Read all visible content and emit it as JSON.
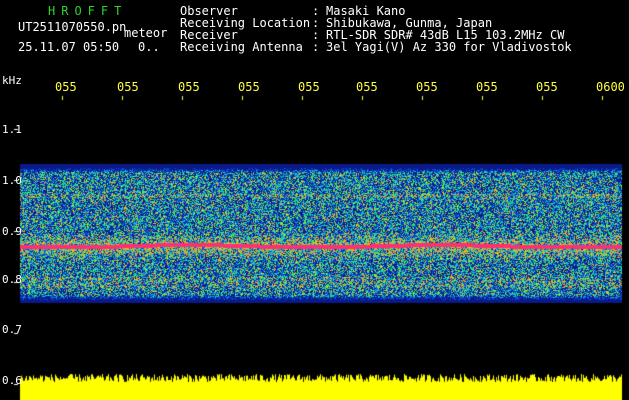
{
  "header": {
    "brand": "HROFFT",
    "filename": "UT2511070550.pn",
    "meteor_label": "meteor",
    "datetime": "25.11.07 05:50",
    "count": "0..",
    "fields": [
      {
        "label": "Observer",
        "value": "Masaki Kano"
      },
      {
        "label": "Receiving Location",
        "value": "Shibukawa, Gunma, Japan"
      },
      {
        "label": "Receiver",
        "value": "RTL-SDR SDR# 43dB L15 103.2MHz CW"
      },
      {
        "label": "Receiving Antenna",
        "value": "3el Yagi(V) Az 330 for Vladivostok"
      }
    ]
  },
  "chart_data": {
    "type": "heatmap",
    "ylabel": "kHz",
    "y_ticks": [
      "1.1",
      "1.0",
      "0.9",
      "0.8",
      "0.7",
      "0.6"
    ],
    "x_ticks": [
      "055",
      "055",
      "055",
      "055",
      "055",
      "055",
      "055",
      "055",
      "055",
      "0600"
    ],
    "signal_band_khz": [
      0.76,
      1.03
    ],
    "carrier_khz": 0.87,
    "colors": {
      "axis_text": "#ffff40",
      "carrier": "#ff3070",
      "background": "#000000",
      "strip": "#ffff00"
    }
  }
}
